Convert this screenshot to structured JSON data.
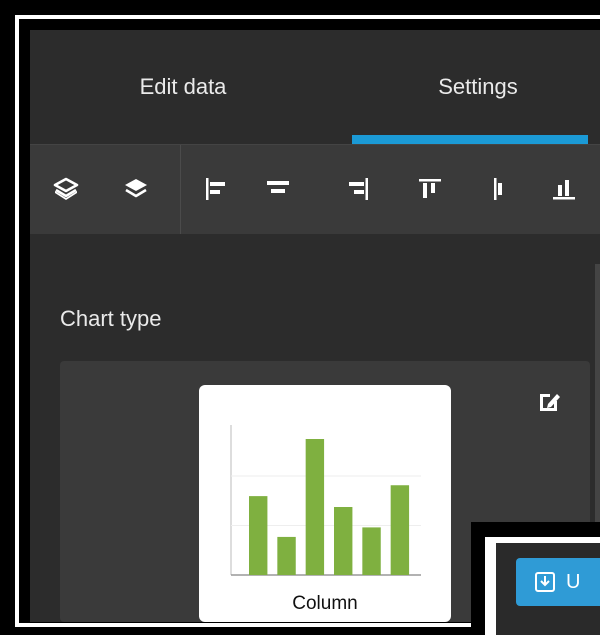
{
  "tabs": {
    "edit_data": "Edit data",
    "settings": "Settings"
  },
  "toolbar": {
    "icons": [
      "layers-bring-forward-icon",
      "layers-send-backward-icon",
      "align-left-icon",
      "align-center-horizontal-icon",
      "align-right-icon",
      "align-top-icon",
      "align-center-vertical-icon",
      "align-bottom-icon"
    ]
  },
  "panel": {
    "section_title": "Chart type",
    "chart_type_label": "Column"
  },
  "preview_chart": {
    "type": "bar",
    "color": "#7fb040",
    "values": [
      58,
      28,
      100,
      50,
      35,
      66
    ]
  },
  "update_button": {
    "label": "U"
  },
  "colors": {
    "accent": "#1b9ad6",
    "background": "#2c2c2c",
    "toolbar": "#3a3a3a"
  }
}
